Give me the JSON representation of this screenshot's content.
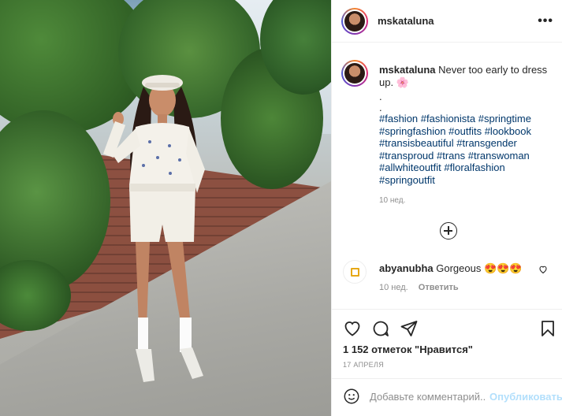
{
  "post": {
    "username": "mskataluna",
    "more_icon": "more-horizontal-icon"
  },
  "caption": {
    "username": "mskataluna",
    "text": "Never too early to dress up.",
    "emoji": "🌸",
    "dot1": ".",
    "dot2": ".",
    "hashtags": "#fashion #fashionista #springtime #springfashion #outfits #lookbook #transisbeautiful #transgender #transproud #trans #transwoman #allwhiteoutfit #floralfashion #springoutfit",
    "time": "10 нед."
  },
  "comments": [
    {
      "username": "abyanubha",
      "text": "Gorgeous 😍😍😍",
      "time": "10 нед.",
      "reply_label": "Ответить"
    }
  ],
  "actions": {
    "likes_text": "1 152 отметок \"Нравится\"",
    "date": "17 АПРЕЛЯ"
  },
  "comment_box": {
    "placeholder": "Добавьте комментарий...",
    "publish_label": "Опубликовать"
  },
  "colors": {
    "link": "#00376b",
    "publish_disabled": "#b2dffc",
    "muted": "#8e8e8e"
  }
}
